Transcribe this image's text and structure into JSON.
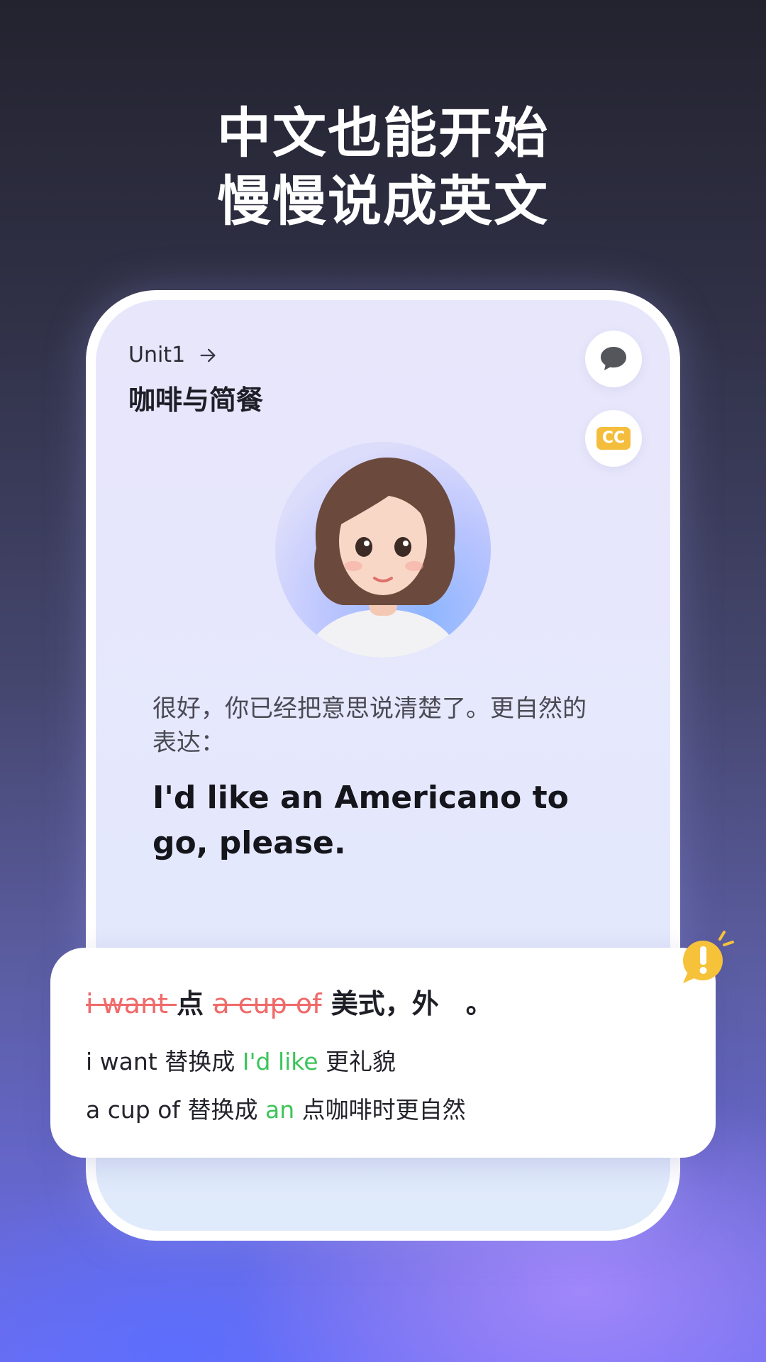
{
  "headline": {
    "line1": "中文也能开始",
    "line2": "慢慢说成英文"
  },
  "lesson": {
    "unit": "Unit1",
    "title": "咖啡与简餐"
  },
  "buttons": {
    "chat_icon": "chat-bubble-icon",
    "cc_label": "CC"
  },
  "tutor": {
    "avatar": "tutor-avatar",
    "hint_cn": "很好，你已经把意思说清楚了。更自然的表达：",
    "hint_en": "I'd like an Americano to go, please."
  },
  "feedback": {
    "wrong1": "i want ",
    "text1": "点 ",
    "wrong2": "a cup of",
    "text2": " 美式，外　。",
    "line2_prefix": "i want 替换成 ",
    "line2_highlight": "I'd like",
    "line2_suffix": " 更礼貌",
    "line3_prefix": "a cup of 替换成 ",
    "line3_highlight": "an",
    "line3_suffix": " 点咖啡时更自然"
  },
  "colors": {
    "accent_green": "#3cc45a",
    "error_red": "#f06a6a",
    "cc_yellow": "#f4be3c",
    "alert_yellow": "#f6c23a"
  }
}
